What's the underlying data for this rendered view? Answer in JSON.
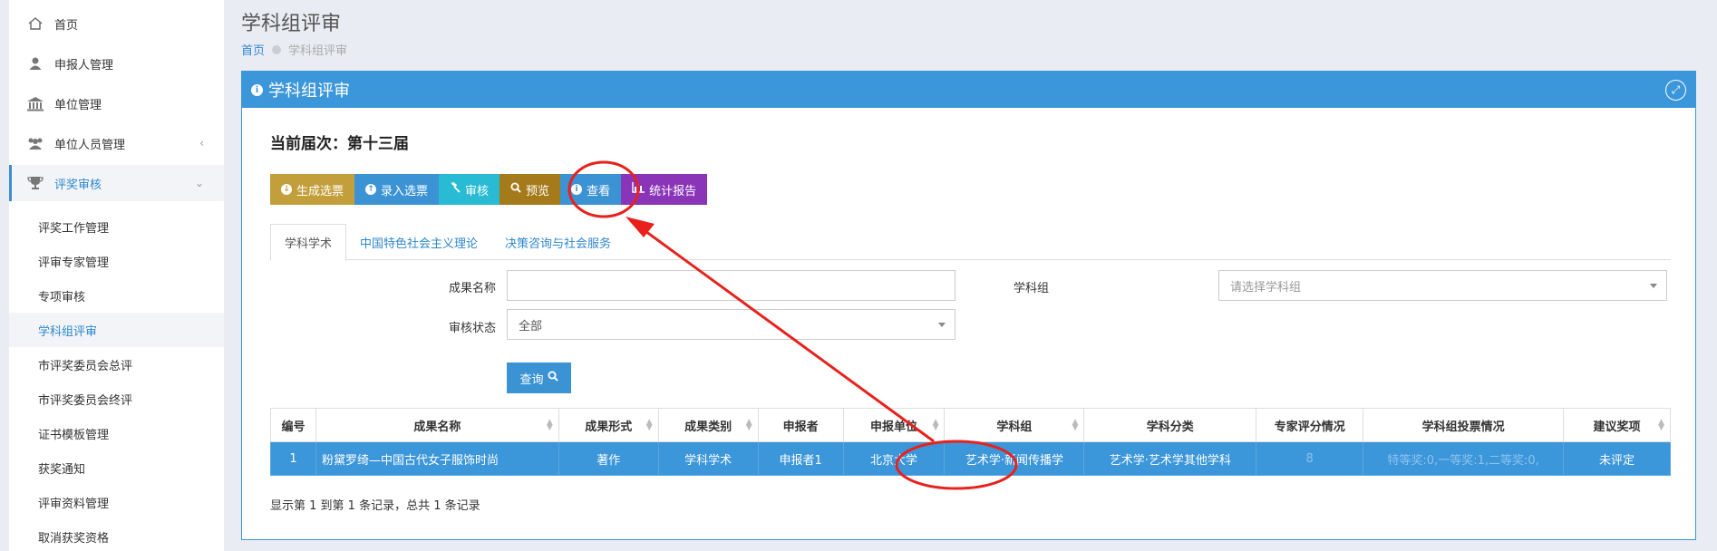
{
  "sidebar": {
    "items": [
      {
        "label": "首页"
      },
      {
        "label": "申报人管理"
      },
      {
        "label": "单位管理"
      },
      {
        "label": "单位人员管理"
      },
      {
        "label": "评奖审核"
      }
    ],
    "subitems": [
      {
        "label": "评奖工作管理"
      },
      {
        "label": "评审专家管理"
      },
      {
        "label": "专项审核"
      },
      {
        "label": "学科组评审"
      },
      {
        "label": "市评奖委员会总评"
      },
      {
        "label": "市评奖委员会终评"
      },
      {
        "label": "证书模板管理"
      },
      {
        "label": "获奖通知"
      },
      {
        "label": "评审资料管理"
      },
      {
        "label": "取消获奖资格"
      }
    ]
  },
  "header": {
    "title": "学科组评审",
    "breadcrumb_home": "首页",
    "breadcrumb_current": "学科组评审"
  },
  "panel": {
    "title": "学科组评审",
    "session_label": "当前届次：第十三届"
  },
  "toolbar": {
    "generate": "生成选票",
    "enter": "录入选票",
    "review": "审核",
    "preview": "预览",
    "view": "查看",
    "report": "统计报告"
  },
  "tabs": [
    {
      "label": "学科学术"
    },
    {
      "label": "中国特色社会主义理论"
    },
    {
      "label": "决策咨询与社会服务"
    }
  ],
  "form": {
    "name_label": "成果名称",
    "name_value": "",
    "group_label": "学科组",
    "group_placeholder": "请选择学科组",
    "status_label": "审核状态",
    "status_value": "全部",
    "query_label": "查询"
  },
  "table": {
    "headers": [
      "编号",
      "成果名称",
      "成果形式",
      "成果类别",
      "申报者",
      "申报单位",
      "学科组",
      "学科分类",
      "专家评分情况",
      "学科组投票情况",
      "建议奖项"
    ],
    "rows": [
      [
        "1",
        "粉黛罗绮—中国古代女子服饰时尚",
        "著作",
        "学科学术",
        "申报者1",
        "北京大学",
        "艺术学·新闻传播学",
        "艺术学·艺术学其他学科",
        "8",
        "特等奖:0,一等奖:1,二等奖:0,",
        "未评定"
      ]
    ]
  },
  "footer": {
    "summary": "显示第 1 到第 1 条记录，总共 1 条记录"
  },
  "colors": {
    "primary": "#3c96da",
    "annotation": "#e8211c"
  }
}
